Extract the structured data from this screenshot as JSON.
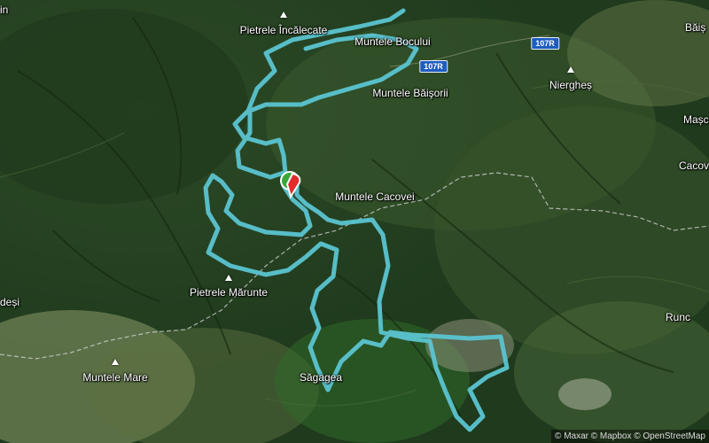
{
  "map": {
    "place_labels": [
      {
        "id": "pietrele-incalecate",
        "text": "Pietrele Încălecate"
      },
      {
        "id": "muntele-bocului",
        "text": "Muntele Bocului"
      },
      {
        "id": "muntele-baisorii",
        "text": "Muntele Băişorii"
      },
      {
        "id": "nierghes",
        "text": "Niergheș"
      },
      {
        "id": "baise",
        "text": "Băiș"
      },
      {
        "id": "mascu",
        "text": "Mașc"
      },
      {
        "id": "cacov",
        "text": "Cacov"
      },
      {
        "id": "muntele-cacovei",
        "text": "Muntele Cacovei"
      },
      {
        "id": "pietrele-marunte",
        "text": "Pietrele Mărunte"
      },
      {
        "id": "muntele-mare",
        "text": "Muntele Mare"
      },
      {
        "id": "sagagea",
        "text": "Săgagea"
      },
      {
        "id": "runc",
        "text": "Runc"
      },
      {
        "id": "desi",
        "text": "deși"
      },
      {
        "id": "in-left",
        "text": "in"
      }
    ],
    "road_shields": [
      {
        "id": "107r-upper",
        "text": "107R"
      },
      {
        "id": "107r-middle",
        "text": "107R"
      }
    ],
    "attribution": "© Maxar © Mapbox © OpenStreetMap",
    "colors": {
      "route": "#5bc4d1",
      "marker_start": "#3aa63a",
      "marker_end": "#e32b2b",
      "road_shield": "#1f5cbf"
    }
  }
}
